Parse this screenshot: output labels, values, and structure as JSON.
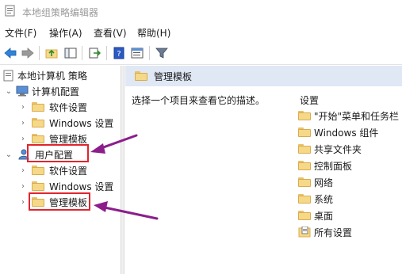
{
  "window": {
    "title": "本地组策略编辑器"
  },
  "menu": {
    "items": [
      "文件(F)",
      "操作(A)",
      "查看(V)",
      "帮助(H)"
    ]
  },
  "toolbar": {
    "icons": [
      "back-arrow-icon",
      "forward-arrow-icon",
      "up-folder-icon",
      "show-hide-tree-icon",
      "export-list-icon",
      "help-icon",
      "properties-icon",
      "filter-icon"
    ]
  },
  "tree": {
    "root": "本地计算机 策略",
    "computer_config": "计算机配置",
    "computer_children": [
      "软件设置",
      "Windows 设置",
      "管理模板"
    ],
    "user_config": "用户配置",
    "user_children": [
      "软件设置",
      "Windows 设置",
      "管理模板"
    ]
  },
  "right": {
    "header_title": "管理模板",
    "description": "选择一个项目来查看它的描述。",
    "column_header": "设置",
    "items": [
      "\"开始\"菜单和任务栏",
      "Windows 组件",
      "共享文件夹",
      "控制面板",
      "网络",
      "系统",
      "桌面",
      "所有设置"
    ]
  },
  "colors": {
    "highlight_box": "#e0252f",
    "annotation_arrow": "#8b1e8b",
    "header_band": "#dfe8f4",
    "folder": "#f6d889"
  }
}
